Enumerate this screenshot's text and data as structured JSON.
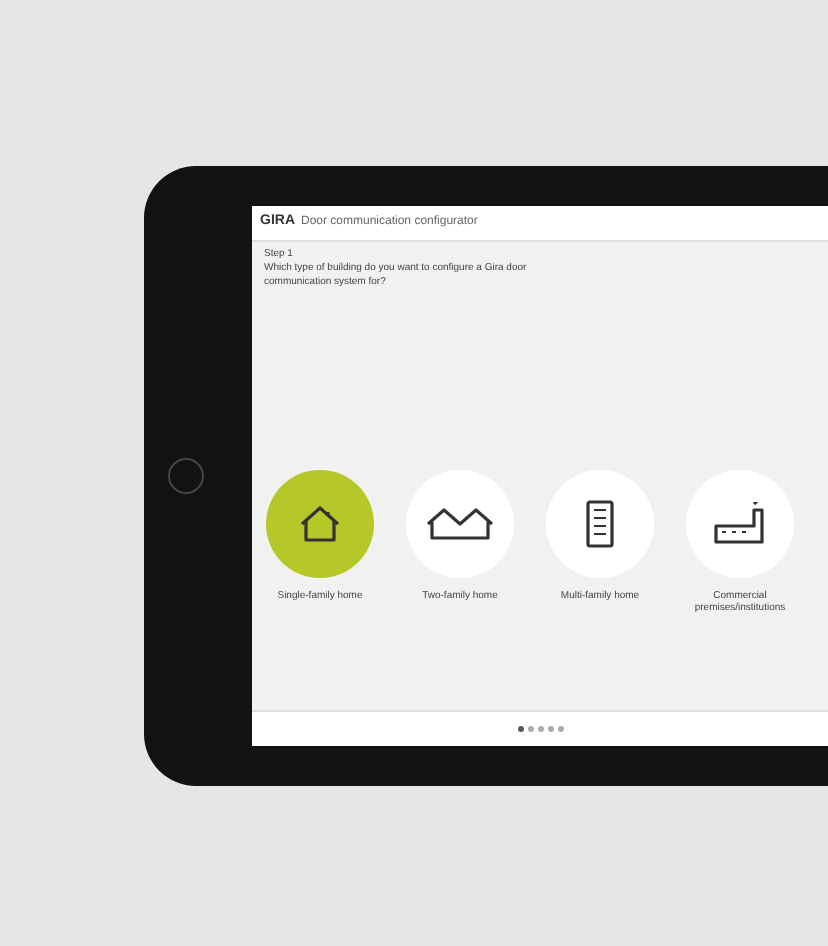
{
  "app": {
    "brand": "GIRA",
    "title": "Door communication configurator"
  },
  "step": {
    "label": "Step 1",
    "question": "Which type of building do you want to configure a Gira door communication system for?"
  },
  "building_types": [
    {
      "kind": "single",
      "label": "Single-family home",
      "selected": true
    },
    {
      "kind": "two",
      "label": "Two-family home",
      "selected": false
    },
    {
      "kind": "multi",
      "label": "Multi-family home",
      "selected": false
    },
    {
      "kind": "commercial",
      "label": "Commercial premises/institutions",
      "selected": false
    }
  ],
  "pager": [
    {
      "selected": true
    },
    {
      "selected": false
    },
    {
      "selected": false
    },
    {
      "selected": false
    },
    {
      "selected": false
    }
  ]
}
